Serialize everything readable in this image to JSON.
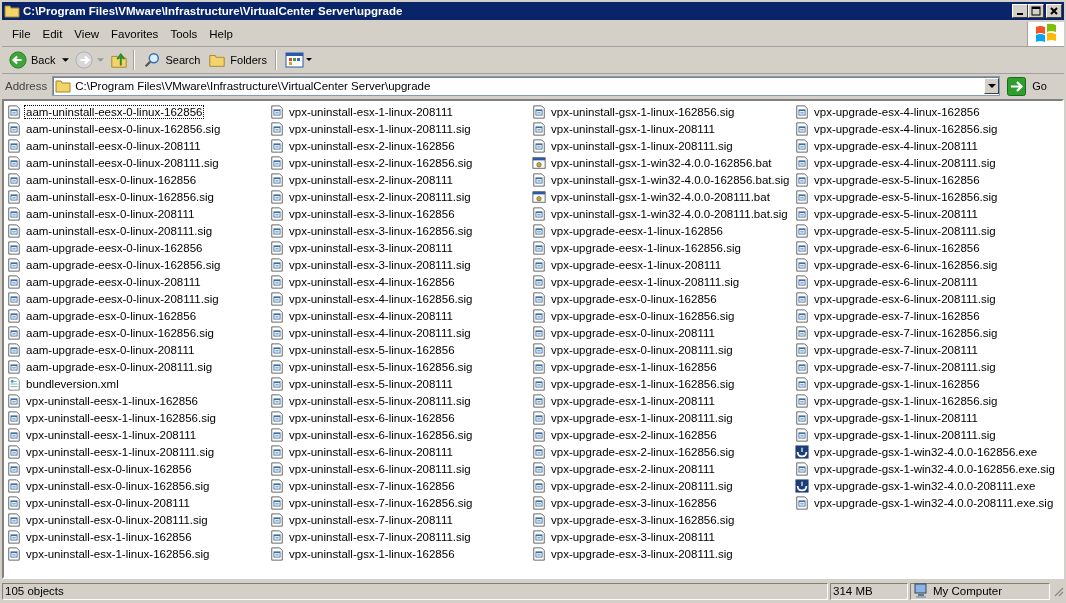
{
  "window": {
    "title": "C:\\Program Files\\VMware\\Infrastructure\\VirtualCenter Server\\upgrade"
  },
  "menu": [
    "File",
    "Edit",
    "View",
    "Favorites",
    "Tools",
    "Help"
  ],
  "toolbar": {
    "back": "Back",
    "search": "Search",
    "folders": "Folders"
  },
  "address": {
    "label": "Address",
    "value": "C:\\Program Files\\VMware\\Infrastructure\\VirtualCenter Server\\upgrade",
    "go": "Go"
  },
  "columns": [
    [
      {
        "name": "aam-uninstall-eesx-0-linux-162856",
        "kind": "file",
        "focused": true
      },
      {
        "name": "aam-uninstall-eesx-0-linux-162856.sig",
        "kind": "file",
        "focused": false
      },
      {
        "name": "aam-uninstall-eesx-0-linux-208111",
        "kind": "file",
        "focused": false
      },
      {
        "name": "aam-uninstall-eesx-0-linux-208111.sig",
        "kind": "file",
        "focused": false
      },
      {
        "name": "aam-uninstall-esx-0-linux-162856",
        "kind": "file",
        "focused": false
      },
      {
        "name": "aam-uninstall-esx-0-linux-162856.sig",
        "kind": "file",
        "focused": false
      },
      {
        "name": "aam-uninstall-esx-0-linux-208111",
        "kind": "file",
        "focused": false
      },
      {
        "name": "aam-uninstall-esx-0-linux-208111.sig",
        "kind": "file",
        "focused": false
      },
      {
        "name": "aam-upgrade-eesx-0-linux-162856",
        "kind": "file",
        "focused": false
      },
      {
        "name": "aam-upgrade-eesx-0-linux-162856.sig",
        "kind": "file",
        "focused": false
      },
      {
        "name": "aam-upgrade-eesx-0-linux-208111",
        "kind": "file",
        "focused": false
      },
      {
        "name": "aam-upgrade-eesx-0-linux-208111.sig",
        "kind": "file",
        "focused": false
      },
      {
        "name": "aam-upgrade-esx-0-linux-162856",
        "kind": "file",
        "focused": false
      },
      {
        "name": "aam-upgrade-esx-0-linux-162856.sig",
        "kind": "file",
        "focused": false
      },
      {
        "name": "aam-upgrade-esx-0-linux-208111",
        "kind": "file",
        "focused": false
      },
      {
        "name": "aam-upgrade-esx-0-linux-208111.sig",
        "kind": "file",
        "focused": false
      },
      {
        "name": "bundleversion.xml",
        "kind": "xml",
        "focused": false
      },
      {
        "name": "vpx-uninstall-eesx-1-linux-162856",
        "kind": "file",
        "focused": false
      },
      {
        "name": "vpx-uninstall-eesx-1-linux-162856.sig",
        "kind": "file",
        "focused": false
      },
      {
        "name": "vpx-uninstall-eesx-1-linux-208111",
        "kind": "file",
        "focused": false
      },
      {
        "name": "vpx-uninstall-eesx-1-linux-208111.sig",
        "kind": "file",
        "focused": false
      },
      {
        "name": "vpx-uninstall-esx-0-linux-162856",
        "kind": "file",
        "focused": false
      },
      {
        "name": "vpx-uninstall-esx-0-linux-162856.sig",
        "kind": "file",
        "focused": false
      },
      {
        "name": "vpx-uninstall-esx-0-linux-208111",
        "kind": "file",
        "focused": false
      },
      {
        "name": "vpx-uninstall-esx-0-linux-208111.sig",
        "kind": "file",
        "focused": false
      },
      {
        "name": "vpx-uninstall-esx-1-linux-162856",
        "kind": "file",
        "focused": false
      },
      {
        "name": "vpx-uninstall-esx-1-linux-162856.sig",
        "kind": "file",
        "focused": false
      }
    ],
    [
      {
        "name": "vpx-uninstall-esx-1-linux-208111",
        "kind": "file",
        "focused": false
      },
      {
        "name": "vpx-uninstall-esx-1-linux-208111.sig",
        "kind": "file",
        "focused": false
      },
      {
        "name": "vpx-uninstall-esx-2-linux-162856",
        "kind": "file",
        "focused": false
      },
      {
        "name": "vpx-uninstall-esx-2-linux-162856.sig",
        "kind": "file",
        "focused": false
      },
      {
        "name": "vpx-uninstall-esx-2-linux-208111",
        "kind": "file",
        "focused": false
      },
      {
        "name": "vpx-uninstall-esx-2-linux-208111.sig",
        "kind": "file",
        "focused": false
      },
      {
        "name": "vpx-uninstall-esx-3-linux-162856",
        "kind": "file",
        "focused": false
      },
      {
        "name": "vpx-uninstall-esx-3-linux-162856.sig",
        "kind": "file",
        "focused": false
      },
      {
        "name": "vpx-uninstall-esx-3-linux-208111",
        "kind": "file",
        "focused": false
      },
      {
        "name": "vpx-uninstall-esx-3-linux-208111.sig",
        "kind": "file",
        "focused": false
      },
      {
        "name": "vpx-uninstall-esx-4-linux-162856",
        "kind": "file",
        "focused": false
      },
      {
        "name": "vpx-uninstall-esx-4-linux-162856.sig",
        "kind": "file",
        "focused": false
      },
      {
        "name": "vpx-uninstall-esx-4-linux-208111",
        "kind": "file",
        "focused": false
      },
      {
        "name": "vpx-uninstall-esx-4-linux-208111.sig",
        "kind": "file",
        "focused": false
      },
      {
        "name": "vpx-uninstall-esx-5-linux-162856",
        "kind": "file",
        "focused": false
      },
      {
        "name": "vpx-uninstall-esx-5-linux-162856.sig",
        "kind": "file",
        "focused": false
      },
      {
        "name": "vpx-uninstall-esx-5-linux-208111",
        "kind": "file",
        "focused": false
      },
      {
        "name": "vpx-uninstall-esx-5-linux-208111.sig",
        "kind": "file",
        "focused": false
      },
      {
        "name": "vpx-uninstall-esx-6-linux-162856",
        "kind": "file",
        "focused": false
      },
      {
        "name": "vpx-uninstall-esx-6-linux-162856.sig",
        "kind": "file",
        "focused": false
      },
      {
        "name": "vpx-uninstall-esx-6-linux-208111",
        "kind": "file",
        "focused": false
      },
      {
        "name": "vpx-uninstall-esx-6-linux-208111.sig",
        "kind": "file",
        "focused": false
      },
      {
        "name": "vpx-uninstall-esx-7-linux-162856",
        "kind": "file",
        "focused": false
      },
      {
        "name": "vpx-uninstall-esx-7-linux-162856.sig",
        "kind": "file",
        "focused": false
      },
      {
        "name": "vpx-uninstall-esx-7-linux-208111",
        "kind": "file",
        "focused": false
      },
      {
        "name": "vpx-uninstall-esx-7-linux-208111.sig",
        "kind": "file",
        "focused": false
      },
      {
        "name": "vpx-uninstall-gsx-1-linux-162856",
        "kind": "file",
        "focused": false
      }
    ],
    [
      {
        "name": "vpx-uninstall-gsx-1-linux-162856.sig",
        "kind": "file",
        "focused": false
      },
      {
        "name": "vpx-uninstall-gsx-1-linux-208111",
        "kind": "file",
        "focused": false
      },
      {
        "name": "vpx-uninstall-gsx-1-linux-208111.sig",
        "kind": "file",
        "focused": false
      },
      {
        "name": "vpx-uninstall-gsx-1-win32-4.0.0-162856.bat",
        "kind": "bat",
        "focused": false
      },
      {
        "name": "vpx-uninstall-gsx-1-win32-4.0.0-162856.bat.sig",
        "kind": "file",
        "focused": false
      },
      {
        "name": "vpx-uninstall-gsx-1-win32-4.0.0-208111.bat",
        "kind": "bat",
        "focused": false
      },
      {
        "name": "vpx-uninstall-gsx-1-win32-4.0.0-208111.bat.sig",
        "kind": "file",
        "focused": false
      },
      {
        "name": "vpx-upgrade-eesx-1-linux-162856",
        "kind": "file",
        "focused": false
      },
      {
        "name": "vpx-upgrade-eesx-1-linux-162856.sig",
        "kind": "file",
        "focused": false
      },
      {
        "name": "vpx-upgrade-eesx-1-linux-208111",
        "kind": "file",
        "focused": false
      },
      {
        "name": "vpx-upgrade-eesx-1-linux-208111.sig",
        "kind": "file",
        "focused": false
      },
      {
        "name": "vpx-upgrade-esx-0-linux-162856",
        "kind": "file",
        "focused": false
      },
      {
        "name": "vpx-upgrade-esx-0-linux-162856.sig",
        "kind": "file",
        "focused": false
      },
      {
        "name": "vpx-upgrade-esx-0-linux-208111",
        "kind": "file",
        "focused": false
      },
      {
        "name": "vpx-upgrade-esx-0-linux-208111.sig",
        "kind": "file",
        "focused": false
      },
      {
        "name": "vpx-upgrade-esx-1-linux-162856",
        "kind": "file",
        "focused": false
      },
      {
        "name": "vpx-upgrade-esx-1-linux-162856.sig",
        "kind": "file",
        "focused": false
      },
      {
        "name": "vpx-upgrade-esx-1-linux-208111",
        "kind": "file",
        "focused": false
      },
      {
        "name": "vpx-upgrade-esx-1-linux-208111.sig",
        "kind": "file",
        "focused": false
      },
      {
        "name": "vpx-upgrade-esx-2-linux-162856",
        "kind": "file",
        "focused": false
      },
      {
        "name": "vpx-upgrade-esx-2-linux-162856.sig",
        "kind": "file",
        "focused": false
      },
      {
        "name": "vpx-upgrade-esx-2-linux-208111",
        "kind": "file",
        "focused": false
      },
      {
        "name": "vpx-upgrade-esx-2-linux-208111.sig",
        "kind": "file",
        "focused": false
      },
      {
        "name": "vpx-upgrade-esx-3-linux-162856",
        "kind": "file",
        "focused": false
      },
      {
        "name": "vpx-upgrade-esx-3-linux-162856.sig",
        "kind": "file",
        "focused": false
      },
      {
        "name": "vpx-upgrade-esx-3-linux-208111",
        "kind": "file",
        "focused": false
      },
      {
        "name": "vpx-upgrade-esx-3-linux-208111.sig",
        "kind": "file",
        "focused": false
      }
    ],
    [
      {
        "name": "vpx-upgrade-esx-4-linux-162856",
        "kind": "file",
        "focused": false
      },
      {
        "name": "vpx-upgrade-esx-4-linux-162856.sig",
        "kind": "file",
        "focused": false
      },
      {
        "name": "vpx-upgrade-esx-4-linux-208111",
        "kind": "file",
        "focused": false
      },
      {
        "name": "vpx-upgrade-esx-4-linux-208111.sig",
        "kind": "file",
        "focused": false
      },
      {
        "name": "vpx-upgrade-esx-5-linux-162856",
        "kind": "file",
        "focused": false
      },
      {
        "name": "vpx-upgrade-esx-5-linux-162856.sig",
        "kind": "file",
        "focused": false
      },
      {
        "name": "vpx-upgrade-esx-5-linux-208111",
        "kind": "file",
        "focused": false
      },
      {
        "name": "vpx-upgrade-esx-5-linux-208111.sig",
        "kind": "file",
        "focused": false
      },
      {
        "name": "vpx-upgrade-esx-6-linux-162856",
        "kind": "file",
        "focused": false
      },
      {
        "name": "vpx-upgrade-esx-6-linux-162856.sig",
        "kind": "file",
        "focused": false
      },
      {
        "name": "vpx-upgrade-esx-6-linux-208111",
        "kind": "file",
        "focused": false
      },
      {
        "name": "vpx-upgrade-esx-6-linux-208111.sig",
        "kind": "file",
        "focused": false
      },
      {
        "name": "vpx-upgrade-esx-7-linux-162856",
        "kind": "file",
        "focused": false
      },
      {
        "name": "vpx-upgrade-esx-7-linux-162856.sig",
        "kind": "file",
        "focused": false
      },
      {
        "name": "vpx-upgrade-esx-7-linux-208111",
        "kind": "file",
        "focused": false
      },
      {
        "name": "vpx-upgrade-esx-7-linux-208111.sig",
        "kind": "file",
        "focused": false
      },
      {
        "name": "vpx-upgrade-gsx-1-linux-162856",
        "kind": "file",
        "focused": false
      },
      {
        "name": "vpx-upgrade-gsx-1-linux-162856.sig",
        "kind": "file",
        "focused": false
      },
      {
        "name": "vpx-upgrade-gsx-1-linux-208111",
        "kind": "file",
        "focused": false
      },
      {
        "name": "vpx-upgrade-gsx-1-linux-208111.sig",
        "kind": "file",
        "focused": false
      },
      {
        "name": "vpx-upgrade-gsx-1-win32-4.0.0-162856.exe",
        "kind": "exe",
        "focused": false
      },
      {
        "name": "vpx-upgrade-gsx-1-win32-4.0.0-162856.exe.sig",
        "kind": "file",
        "focused": false
      },
      {
        "name": "vpx-upgrade-gsx-1-win32-4.0.0-208111.exe",
        "kind": "exe",
        "focused": false
      },
      {
        "name": "vpx-upgrade-gsx-1-win32-4.0.0-208111.exe.sig",
        "kind": "file",
        "focused": false
      }
    ]
  ],
  "status_bar": {
    "objects": "105 objects",
    "size": "314 MB",
    "zone": "My Computer"
  }
}
